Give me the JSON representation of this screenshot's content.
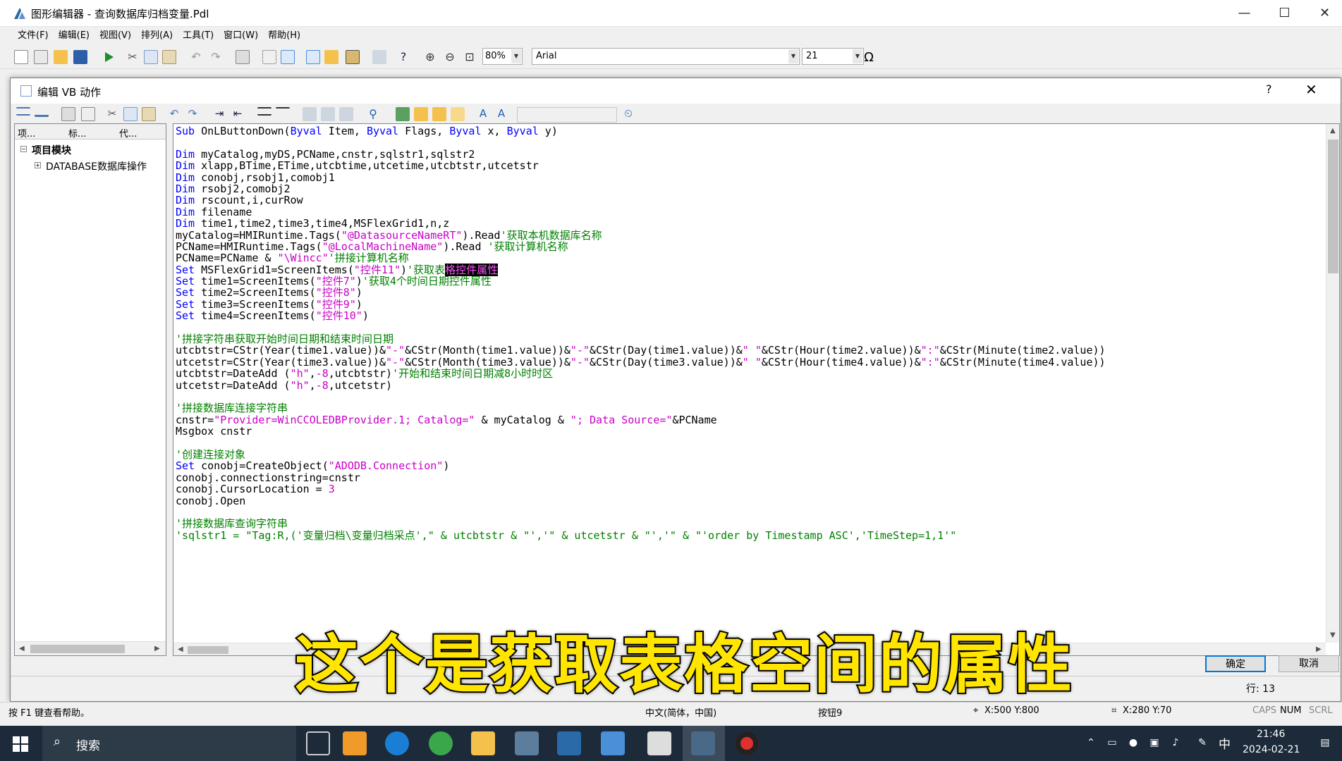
{
  "window": {
    "title": "图形编辑器 - 查询数据库归档变量.Pdl",
    "minimize": "—",
    "maximize": "☐",
    "close": "✕"
  },
  "menu": [
    "文件(F)",
    "编辑(E)",
    "视图(V)",
    "排列(A)",
    "工具(T)",
    "窗口(W)",
    "帮助(H)"
  ],
  "toolbar": {
    "zoom": "80%",
    "font": "Arial",
    "font_size": "21",
    "omega": "Ω"
  },
  "dialog": {
    "title": "编辑 VB 动作",
    "help": "?",
    "close": "✕",
    "ok_label": "确定",
    "cancel_label": "取消",
    "row_label": "行: 13"
  },
  "tree": {
    "tabs": [
      "项...",
      "标...",
      "代..."
    ],
    "root": "项目模块",
    "child": "DATABASE数据库操作"
  },
  "code": {
    "lines": [
      [
        [
          "kw",
          "Sub"
        ],
        [
          "t",
          " OnLButtonDown("
        ],
        [
          "kw",
          "Byval"
        ],
        [
          "t",
          " Item, "
        ],
        [
          "kw",
          "Byval"
        ],
        [
          "t",
          " Flags, "
        ],
        [
          "kw",
          "Byval"
        ],
        [
          "t",
          " x, "
        ],
        [
          "kw",
          "Byval"
        ],
        [
          "t",
          " y)"
        ]
      ],
      [],
      [
        [
          "kw",
          "Dim"
        ],
        [
          "t",
          " myCatalog,myDS,PCName,cnstr,sqlstr1,sqlstr2"
        ]
      ],
      [
        [
          "kw",
          "Dim"
        ],
        [
          "t",
          " xlapp,BTime,ETime,utcbtime,utcetime,utcbtstr,utcetstr"
        ]
      ],
      [
        [
          "kw",
          "Dim"
        ],
        [
          "t",
          " conobj,rsobj1,comobj1"
        ]
      ],
      [
        [
          "kw",
          "Dim"
        ],
        [
          "t",
          " rsobj2,comobj2"
        ]
      ],
      [
        [
          "kw",
          "Dim"
        ],
        [
          "t",
          " rscount,i,curRow"
        ]
      ],
      [
        [
          "kw",
          "Dim"
        ],
        [
          "t",
          " filename"
        ]
      ],
      [
        [
          "kw",
          "Dim"
        ],
        [
          "t",
          " time1,time2,time3,time4,MSFlexGrid1,n,z"
        ]
      ],
      [
        [
          "t",
          "myCatalog=HMIRuntime.Tags("
        ],
        [
          "str",
          "\"@DatasourceNameRT\""
        ],
        [
          "t",
          ").Read"
        ],
        [
          "cm",
          "'获取本机数据库名称"
        ]
      ],
      [
        [
          "t",
          "PCName=HMIRuntime.Tags("
        ],
        [
          "str",
          "\"@LocalMachineName\""
        ],
        [
          "t",
          ").Read "
        ],
        [
          "cm",
          "'获取计算机名称"
        ]
      ],
      [
        [
          "t",
          "PCName=PCName & "
        ],
        [
          "str",
          "\"\\Wincc\""
        ],
        [
          "cm",
          "'拼接计算机名称"
        ]
      ],
      [
        [
          "kw",
          "Set"
        ],
        [
          "t",
          " MSFlexGrid1=ScreenItems("
        ],
        [
          "str",
          "\"控件11\""
        ],
        [
          "t",
          ")"
        ],
        [
          "cm",
          "'获取表"
        ],
        [
          "sel",
          "格控件属性"
        ]
      ],
      [
        [
          "kw",
          "Set"
        ],
        [
          "t",
          " time1=ScreenItems("
        ],
        [
          "str",
          "\"控件7\""
        ],
        [
          "t",
          ")"
        ],
        [
          "cm",
          "'获取4个时间日期控件属性"
        ]
      ],
      [
        [
          "kw",
          "Set"
        ],
        [
          "t",
          " time2=ScreenItems("
        ],
        [
          "str",
          "\"控件8\""
        ],
        [
          "t",
          ")"
        ]
      ],
      [
        [
          "kw",
          "Set"
        ],
        [
          "t",
          " time3=ScreenItems("
        ],
        [
          "str",
          "\"控件9\""
        ],
        [
          "t",
          ")"
        ]
      ],
      [
        [
          "kw",
          "Set"
        ],
        [
          "t",
          " time4=ScreenItems("
        ],
        [
          "str",
          "\"控件10\""
        ],
        [
          "t",
          ")"
        ]
      ],
      [],
      [
        [
          "cm",
          "'拼接字符串获取开始时间日期和结束时间日期"
        ]
      ],
      [
        [
          "t",
          "utcbtstr=CStr(Year(time1.value))&"
        ],
        [
          "str",
          "\"-\""
        ],
        [
          "t",
          "&CStr(Month(time1.value))&"
        ],
        [
          "str",
          "\"-\""
        ],
        [
          "t",
          "&CStr(Day(time1.value))&"
        ],
        [
          "str",
          "\" \""
        ],
        [
          "t",
          "&CStr(Hour(time2.value))&"
        ],
        [
          "str",
          "\":\""
        ],
        [
          "t",
          "&CStr(Minute(time2.value))"
        ]
      ],
      [
        [
          "t",
          "utcetstr=CStr(Year(time3.value))&"
        ],
        [
          "str",
          "\"-\""
        ],
        [
          "t",
          "&CStr(Month(time3.value))&"
        ],
        [
          "str",
          "\"-\""
        ],
        [
          "t",
          "&CStr(Day(time3.value))&"
        ],
        [
          "str",
          "\" \""
        ],
        [
          "t",
          "&CStr(Hour(time4.value))&"
        ],
        [
          "str",
          "\":\""
        ],
        [
          "t",
          "&CStr(Minute(time4.value))"
        ]
      ],
      [
        [
          "t",
          "utcbtstr=DateAdd ("
        ],
        [
          "str",
          "\"h\""
        ],
        [
          "t",
          ","
        ],
        [
          "str",
          "-8"
        ],
        [
          "t",
          ",utcbtstr)"
        ],
        [
          "cm",
          "'开始和结束时间日期减8小时时区"
        ]
      ],
      [
        [
          "t",
          "utcetstr=DateAdd ("
        ],
        [
          "str",
          "\"h\""
        ],
        [
          "t",
          ","
        ],
        [
          "str",
          "-8"
        ],
        [
          "t",
          ",utcetstr)"
        ]
      ],
      [],
      [
        [
          "cm",
          "'拼接数据库连接字符串"
        ]
      ],
      [
        [
          "t",
          "cnstr="
        ],
        [
          "str",
          "\"Provider=WinCCOLEDBProvider.1; Catalog=\""
        ],
        [
          "t",
          " & myCatalog & "
        ],
        [
          "str",
          "\"; Data Source=\""
        ],
        [
          "t",
          "&PCName"
        ]
      ],
      [
        [
          "t",
          "Msgbox cnstr"
        ]
      ],
      [],
      [
        [
          "cm",
          "'创建连接对象"
        ]
      ],
      [
        [
          "kw",
          "Set"
        ],
        [
          "t",
          " conobj=CreateObject("
        ],
        [
          "str",
          "\"ADODB.Connection\""
        ],
        [
          "t",
          ")"
        ]
      ],
      [
        [
          "t",
          "conobj.connectionstring=cnstr"
        ]
      ],
      [
        [
          "t",
          "conobj.CursorLocation = "
        ],
        [
          "str",
          "3"
        ]
      ],
      [
        [
          "t",
          "conobj.Open"
        ]
      ],
      [],
      [
        [
          "cm",
          "'拼接数据库查询字符串"
        ]
      ],
      [
        [
          "cm",
          "'sqlstr1 = \"Tag:R,('变量归档\\变量归档采点',\" & utcbtstr & \"','\" & utcetstr & \"','\" & \"'order by Timestamp ASC','TimeStep=1,1'\""
        ]
      ]
    ]
  },
  "status": {
    "help": "按 F1 键查看帮助。",
    "locale": "中文(简体，中国)",
    "object": "按钮9",
    "pos": "X:500 Y:800",
    "size": "X:280 Y:70",
    "caps": "CAPS",
    "num": "NUM",
    "scrl": "SCRL"
  },
  "taskbar": {
    "search": "搜索",
    "ime": "中",
    "time": "21:46",
    "date": "2024-02-21"
  },
  "subtitle": "这个是获取表格空间的属性"
}
